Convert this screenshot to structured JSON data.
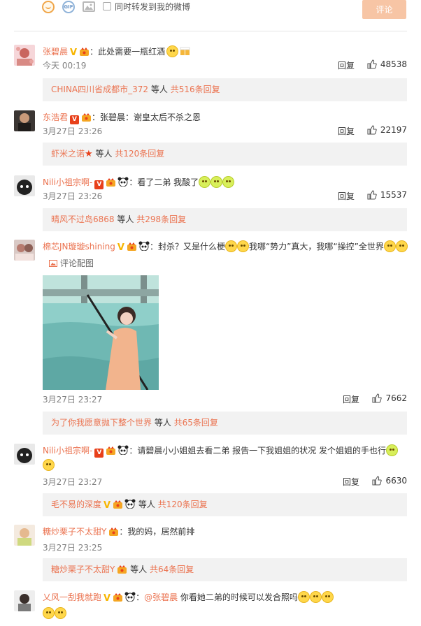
{
  "composer": {
    "icons": [
      "smiley-icon",
      "gif-icon",
      "image-icon"
    ],
    "gif_label": "GIF",
    "repost_label": "同时转发到我的微博",
    "submit_label": "评论"
  },
  "colors": {
    "accent": "#eb7350",
    "submit_bg": "#f7c5a5",
    "sub_bg": "#f2f2f2",
    "meta": "#808080"
  },
  "comments": [
    {
      "user": "张碧晨",
      "text": "此处需要一瓶红酒",
      "time": "今天 00:19",
      "reply": "回复",
      "likes": "48538",
      "sub": {
        "user": "CHINA四川省成都市_372",
        "mid": " 等人 ",
        "count": "共516条回复"
      }
    },
    {
      "user": "东浩君",
      "text": "张碧晨：谢皇太后不杀之恩",
      "time": "3月27日 23:26",
      "reply": "回复",
      "likes": "22197",
      "sub": {
        "user": "虾米之诺",
        "mid": " 等人 ",
        "count": "共120条回复"
      }
    },
    {
      "user": "Nili小祖宗啊-",
      "text": "看了二弟 我酸了",
      "time": "3月27日 23:26",
      "reply": "回复",
      "likes": "15537",
      "sub": {
        "user": "晴风不过岛6868",
        "mid": " 等人 ",
        "count": "共298条回复"
      }
    },
    {
      "user": "棉芯JN璇璇shining",
      "text": "封杀？又是什么梗",
      "text2": "我哪“势力”真大，我哪“操控”全世界",
      "pic_link": "评论配图",
      "time": "3月27日 23:27",
      "reply": "回复",
      "likes": "7662",
      "sub": {
        "user": "为了你我愿意抛下整个世界",
        "mid": " 等人 ",
        "count": "共65条回复"
      }
    },
    {
      "user": "Nili小祖宗啊-",
      "text": "请碧晨小小姐姐去看二弟 报告一下我姐姐的状况 发个姐姐的手也行",
      "time": "3月27日 23:27",
      "reply": "回复",
      "likes": "6630",
      "sub": {
        "user": "毛不易的深度",
        "mid": " 等人 ",
        "count": "共120条回复"
      }
    },
    {
      "user": "糖炒栗子不太甜Y",
      "text": "我的妈，居然前排",
      "time": "3月27日 23:25",
      "reply": "回复",
      "likes": "",
      "sub": {
        "user": "糖炒栗子不太甜Y",
        "mid": " 等人 ",
        "count": "共64条回复"
      }
    },
    {
      "user": "乂风一刮我就跑",
      "text_at": "@张碧晨",
      "text": " 你看她二弟的时候可以发合照吗"
    }
  ]
}
